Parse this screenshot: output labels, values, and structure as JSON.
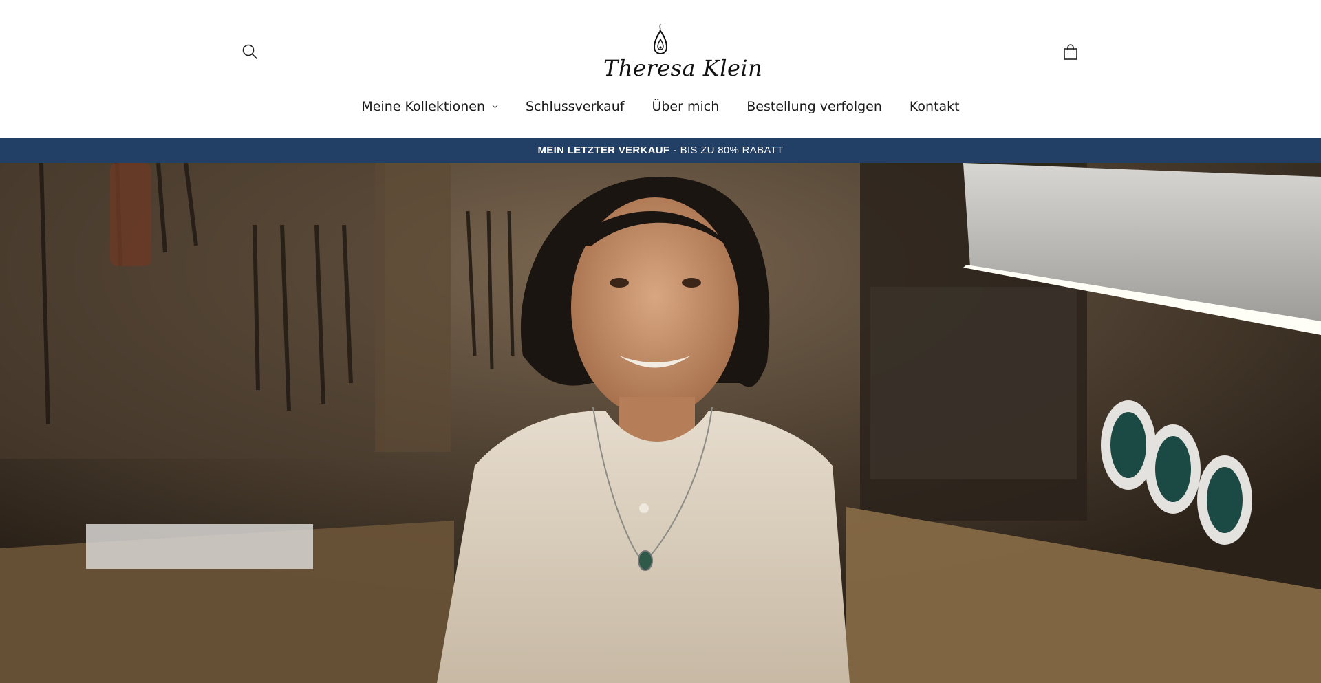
{
  "header": {
    "brand": "Theresa Klein",
    "search_icon": "search-icon",
    "cart_icon": "shopping-bag-icon",
    "logo_mark_icon": "teardrop-pendant-icon"
  },
  "nav": {
    "items": [
      {
        "label": "Meine Kollektionen",
        "has_dropdown": true
      },
      {
        "label": "Schlussverkauf"
      },
      {
        "label": "Über mich"
      },
      {
        "label": "Bestellung verfolgen"
      },
      {
        "label": "Kontakt"
      }
    ]
  },
  "announcement": {
    "bold": "MEIN LETZTER VERKAUF",
    "separator": "-",
    "text": "BIS ZU 80% RABATT",
    "background": "#223f66"
  },
  "hero": {
    "image": "jewelry-maker-portrait"
  }
}
